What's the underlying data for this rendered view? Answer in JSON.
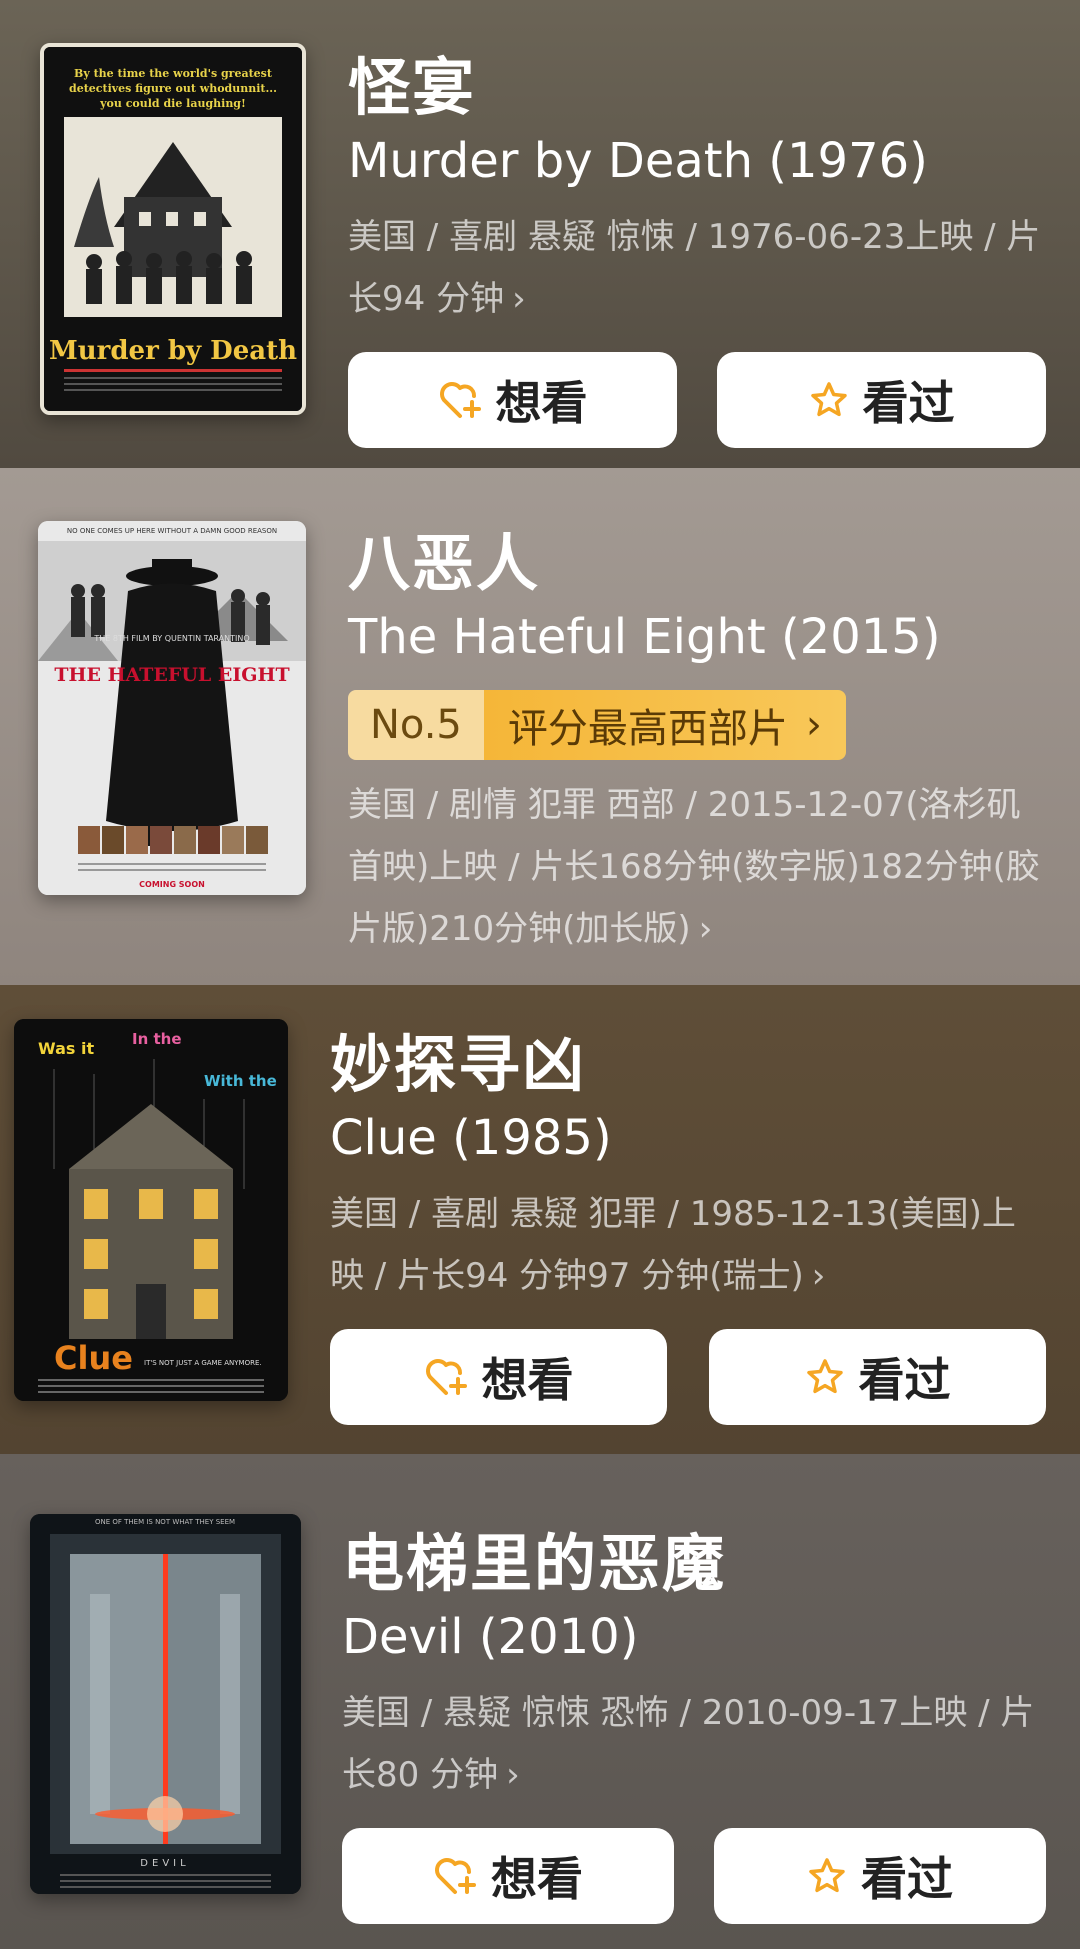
{
  "movies": [
    {
      "title_cn": "怪宴",
      "title_en": "Murder by Death (1976)",
      "meta": "美国 / 喜剧 悬疑 惊悚 / 1976-06-23上映 / 片长94 分钟",
      "chevron": "›",
      "poster_tagline": "By the time the world's greatest detectives figure out whodunnit... you could die laughing!",
      "poster_title": "Murder by Death",
      "bg_color": "#5f574b",
      "buttons": {
        "want": "想看",
        "seen": "看过"
      }
    },
    {
      "title_cn": "八恶人",
      "title_en": "The Hateful Eight (2015)",
      "rank_no": "No.5",
      "rank_label": "评分最高西部片",
      "rank_chevron": "›",
      "meta": "美国 / 剧情 犯罪 西部 / 2015-12-07(洛杉矶首映)上映 / 片长168分钟(数字版)182分钟(胶片版)210分钟(加长版)",
      "chevron": "›",
      "poster_top": "NO ONE COMES UP HERE WITHOUT A DAMN GOOD REASON",
      "poster_credit": "THE 8TH FILM BY QUENTIN TARANTINO",
      "poster_title": "THE HATEFUL EIGHT",
      "poster_foot": "COMING SOON",
      "bg_color": "#9c918a"
    },
    {
      "title_cn": "妙探寻凶",
      "title_en": "Clue (1985)",
      "meta": "美国 / 喜剧 悬疑 犯罪 / 1985-12-13(美国)上映 / 片长94 分钟97 分钟(瑞士)",
      "chevron": "›",
      "poster_words": [
        "Was it",
        "In the",
        "With the"
      ],
      "poster_title": "Clue",
      "poster_tag": "IT'S NOT JUST A GAME ANYMORE.",
      "bg_color": "#5a4a35",
      "buttons": {
        "want": "想看",
        "seen": "看过"
      }
    },
    {
      "title_cn": "电梯里的恶魔",
      "title_en": "Devil (2010)",
      "meta": "美国 / 悬疑 惊悚 恐怖 / 2010-09-17上映 / 片长80 分钟",
      "chevron": "›",
      "poster_top": "ONE OF THEM IS NOT WHAT THEY SEEM",
      "poster_title": "DEVIL",
      "bg_color": "#625c57",
      "buttons": {
        "want": "想看",
        "seen": "看过"
      }
    }
  ],
  "colors": {
    "icon_accent": "#f5a623"
  }
}
